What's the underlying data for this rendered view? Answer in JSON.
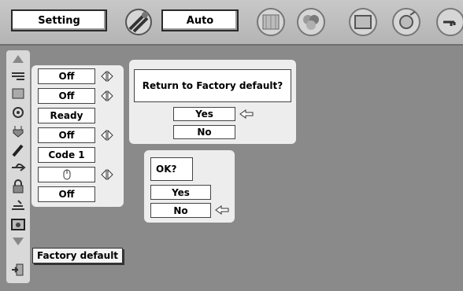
{
  "topbar": {
    "setting_label": "Setting",
    "mode_label": "Auto"
  },
  "tooltip": {
    "label": "Factory default"
  },
  "values": [
    "Off",
    "Off",
    "Ready",
    "Off",
    "Code 1",
    "",
    "Off"
  ],
  "dialog1": {
    "question": "Return to Factory default?",
    "yes": "Yes",
    "no": "No"
  },
  "dialog2": {
    "question": "OK?",
    "yes": "Yes",
    "no": "No"
  }
}
